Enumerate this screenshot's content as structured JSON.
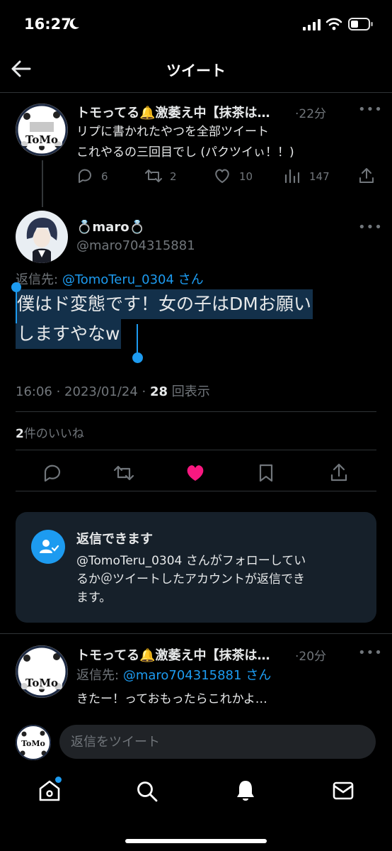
{
  "status_bar": {
    "time": "16:27"
  },
  "header": {
    "title": "ツイート"
  },
  "parent_tweet": {
    "author": "トモってる🔔激萎え中【抹茶は…",
    "time": "22分",
    "line1": "リプに書かれたやつを全部ツイート",
    "line2": "これやるの三回目でし (パクツイぃ！！)",
    "replies": "6",
    "retweets": "2",
    "likes": "10",
    "views": "147",
    "avatar_text": "ToMo"
  },
  "main_tweet": {
    "author": "💍maro💍",
    "handle": "@maro704315881",
    "reply_to_label": "返信先:",
    "reply_to_handle": "@TomoTeru_0304",
    "reply_to_suffix": "さん",
    "text_line1": "僕はド変態です！女の子はDMお願い",
    "text_line2": "しますやなw",
    "timestamp": "16:06 · 2023/01/24 · ",
    "views_count": "28",
    "views_label": "回表示",
    "likes_count": "2",
    "likes_label": "件のいいね"
  },
  "reply_card": {
    "title": "返信できます",
    "line1": "@TomoTeru_0304 さんがフォローしてい",
    "line2": "るか＠ツイートしたアカウントが返信でき",
    "line3": "ます。"
  },
  "reply_tweet": {
    "author": "トモってる🔔激萎え中【抹茶は…",
    "time": "20分",
    "reply_to_label": "返信先:",
    "reply_to_handle": "@maro704315881",
    "reply_to_suffix": "さん",
    "text": "きたー！っておもったらこれかよ…",
    "avatar_text": "ToMo"
  },
  "composer": {
    "placeholder": "返信をツイート",
    "avatar_text": "ToMo"
  },
  "colors": {
    "accent": "#1d9bf0",
    "like": "#f91880",
    "muted": "#71767b"
  }
}
